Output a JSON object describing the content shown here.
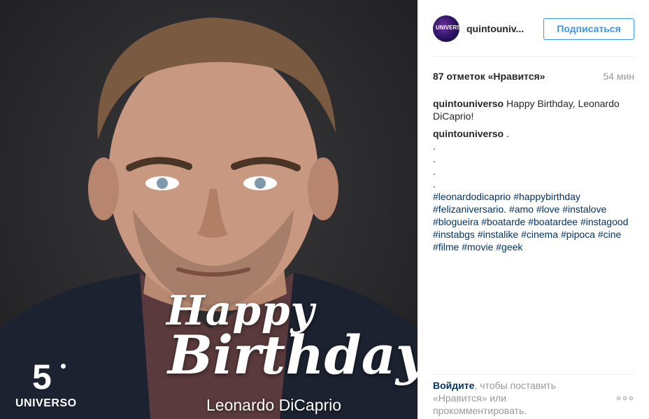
{
  "post": {
    "overlay": {
      "happy": "Happy",
      "birthday": "Birthday",
      "name": "Leonardo DiCaprio",
      "logo_number": "5",
      "logo_brand": "UNIVERSO"
    }
  },
  "header": {
    "avatar_text": "UNIVERSO",
    "username": "quintouniv...",
    "follow_label": "Подписаться"
  },
  "stats": {
    "likes": "87 отметок «Нравится»",
    "time": "54 мин"
  },
  "comments": [
    {
      "author": "quintouniverso",
      "text": "Happy Birthday, Leonardo DiCaprio!"
    },
    {
      "author": "quintouniverso",
      "text": ".",
      "dots": [
        ".",
        ".",
        ".",
        "."
      ],
      "hashtags": "#leonardodicaprio #happybirthday #felizaniversario. #amo #love #instalove #blogueira #boatarde #boatardee #instagood #instabgs #instalike #cinema #pipoca #cine #filme #movie #geek"
    }
  ],
  "footer": {
    "login_label": "Войдите",
    "text": ", чтобы поставить «Нравится» или прокомментировать."
  },
  "colors": {
    "accent": "#3897f0",
    "link": "#003569",
    "muted": "#999999"
  },
  "icons": {
    "more": "more-dots-icon"
  }
}
